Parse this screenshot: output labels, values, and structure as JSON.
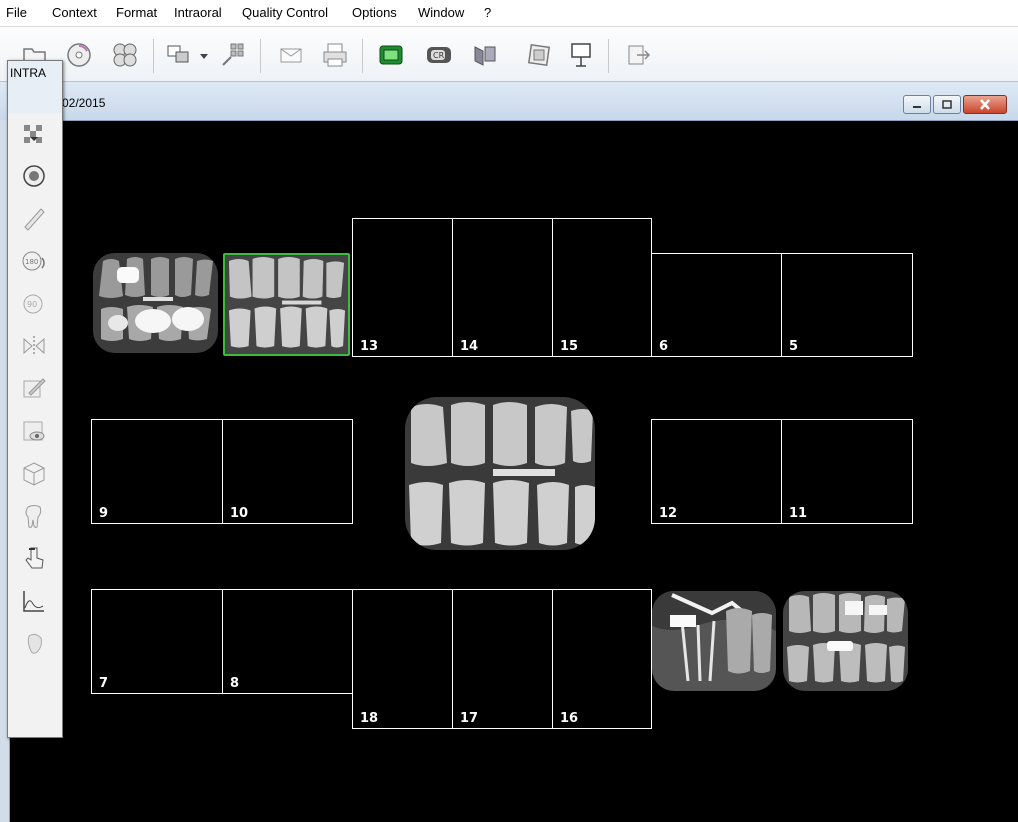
{
  "menu": [
    "File",
    "Context",
    "Format",
    "Intraoral",
    "Quality Control",
    "Options",
    "Window",
    "?"
  ],
  "toolbar_icons": [
    "folder-open-icon",
    "cd-icon",
    "disk-group-icon",
    "copy-layout-icon",
    "dropdown-arrow-icon",
    "transfer-icon",
    "email-icon",
    "print-icon",
    "green-monitor-icon",
    "cr-scanner-icon",
    "acquire-icon",
    "frame-icon",
    "presentation-icon",
    "exit-icon"
  ],
  "window": {
    "title": "02/2015"
  },
  "palette": {
    "label": "INTRA",
    "tools": [
      "contrast-icon",
      "invert-icon",
      "measure-icon",
      "rotate-180-icon",
      "rotate-90-icon",
      "flip-icon",
      "annotate-icon",
      "zoom-view-icon",
      "3d-box-icon",
      "tooth-icon",
      "hand-pointer-icon",
      "histogram-icon",
      "foot-icon"
    ]
  },
  "slots": {
    "s13": "13",
    "s14": "14",
    "s15": "15",
    "s6": "6",
    "s5": "5",
    "s9": "9",
    "s10": "10",
    "s12": "12",
    "s11": "11",
    "s7": "7",
    "s8": "8",
    "s18": "18",
    "s17": "17",
    "s16": "16"
  },
  "colors": {
    "selection": "#3dbb3d",
    "background": "#000000",
    "slot_border": "#ffffff"
  }
}
